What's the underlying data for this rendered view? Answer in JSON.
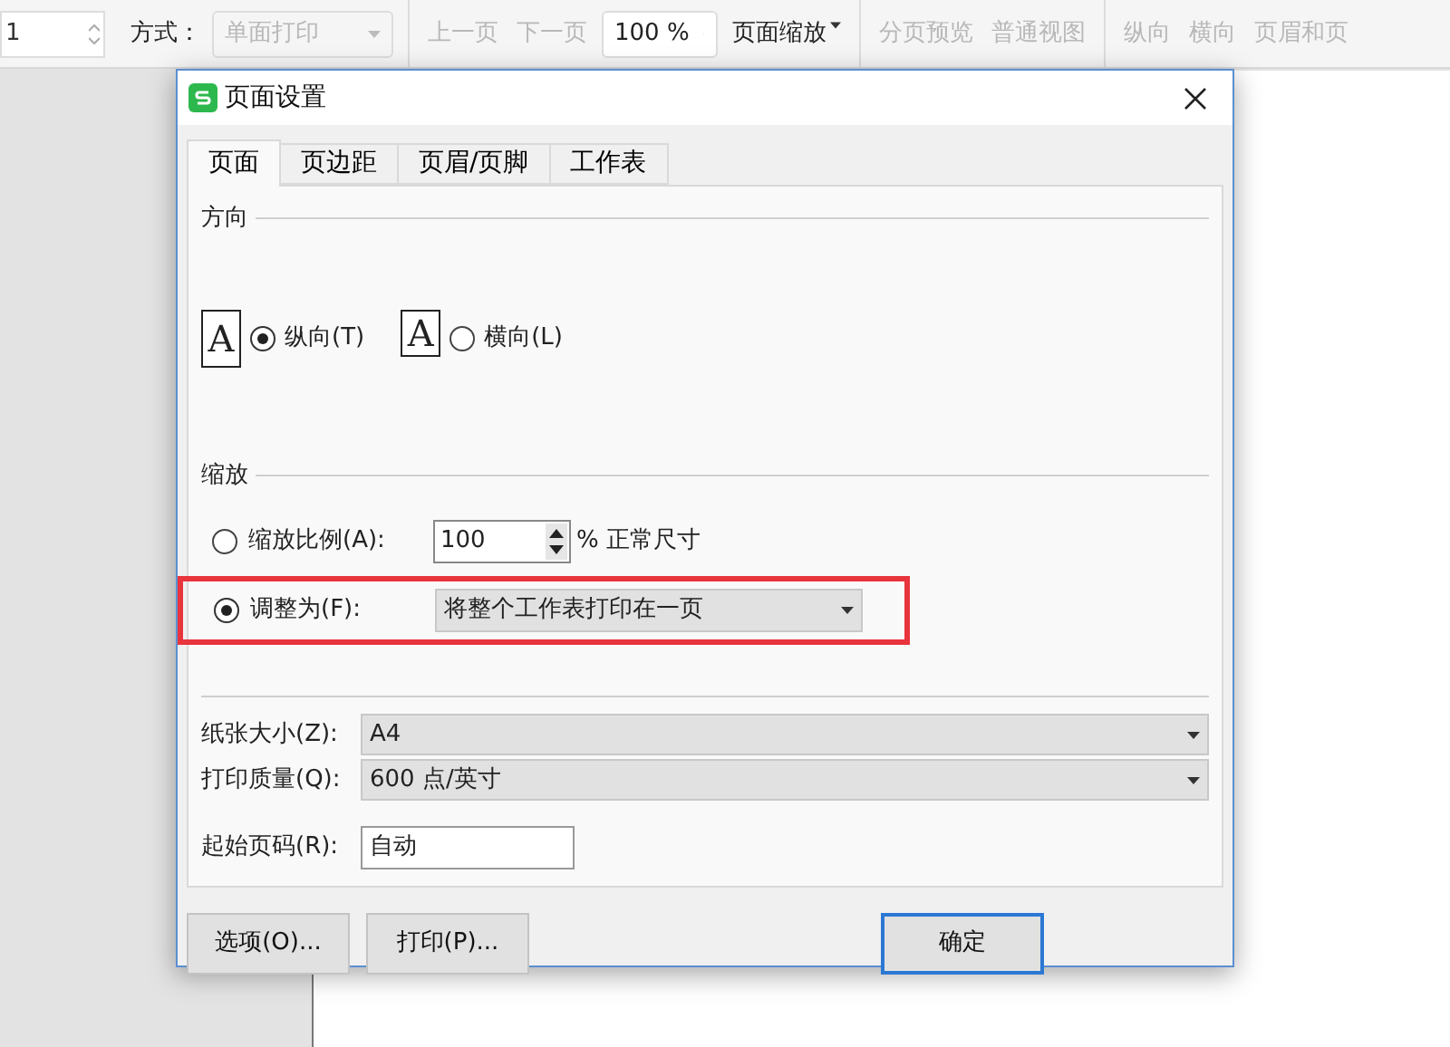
{
  "toolbar": {
    "groups": [
      [
        {
          "kind": "spinner",
          "value": "1"
        },
        {
          "kind": "label",
          "text": "方式："
        },
        {
          "kind": "dropdown",
          "value": "单面打印",
          "disabled": true
        }
      ],
      [
        {
          "kind": "button",
          "text": "上一页",
          "disabled": true
        },
        {
          "kind": "button",
          "text": "下一页",
          "disabled": true
        },
        {
          "kind": "dropdown",
          "value": "100 %",
          "disabled": false
        },
        {
          "kind": "menu",
          "text": "页面缩放",
          "disabled": false
        }
      ],
      [
        {
          "kind": "button",
          "text": "分页预览",
          "disabled": true
        },
        {
          "kind": "button",
          "text": "普通视图",
          "disabled": true
        }
      ],
      [
        {
          "kind": "button",
          "text": "纵向",
          "disabled": true
        },
        {
          "kind": "button",
          "text": "横向",
          "disabled": true
        },
        {
          "kind": "button",
          "text": "页眉和页",
          "disabled": true
        }
      ]
    ]
  },
  "dialog": {
    "title": "页面设置",
    "tabs": [
      {
        "label": "页面",
        "selected": true
      },
      {
        "label": "页边距",
        "selected": false
      },
      {
        "label": "页眉/页脚",
        "selected": false
      },
      {
        "label": "工作表",
        "selected": false
      }
    ],
    "orientation": {
      "heading": "方向",
      "options": [
        {
          "kind": "portrait",
          "icon_letter": "A",
          "label": "纵向(T)",
          "selected": true
        },
        {
          "kind": "landscape",
          "icon_letter": "A",
          "label": "横向(L)",
          "selected": false
        }
      ]
    },
    "scaling": {
      "heading": "缩放",
      "options": [
        {
          "kind": "percent",
          "label": "缩放比例(A):",
          "selected": false,
          "value": "100",
          "suffix": "% 正常尺寸"
        },
        {
          "kind": "fit",
          "label": "调整为(F):",
          "selected": true,
          "value": "将整个工作表打印在一页"
        }
      ]
    },
    "fields": [
      {
        "kind": "dropdown",
        "label": "纸张大小(Z):",
        "value": "A4"
      },
      {
        "kind": "dropdown",
        "label": "打印质量(Q):",
        "value": "600 点/英寸"
      },
      {
        "kind": "text",
        "label": "起始页码(R):",
        "value": "自动"
      }
    ],
    "buttons": [
      {
        "label": "选项(O)...",
        "default": false
      },
      {
        "label": "打印(P)...",
        "default": false
      },
      {
        "label": "确定",
        "default": true
      }
    ]
  }
}
